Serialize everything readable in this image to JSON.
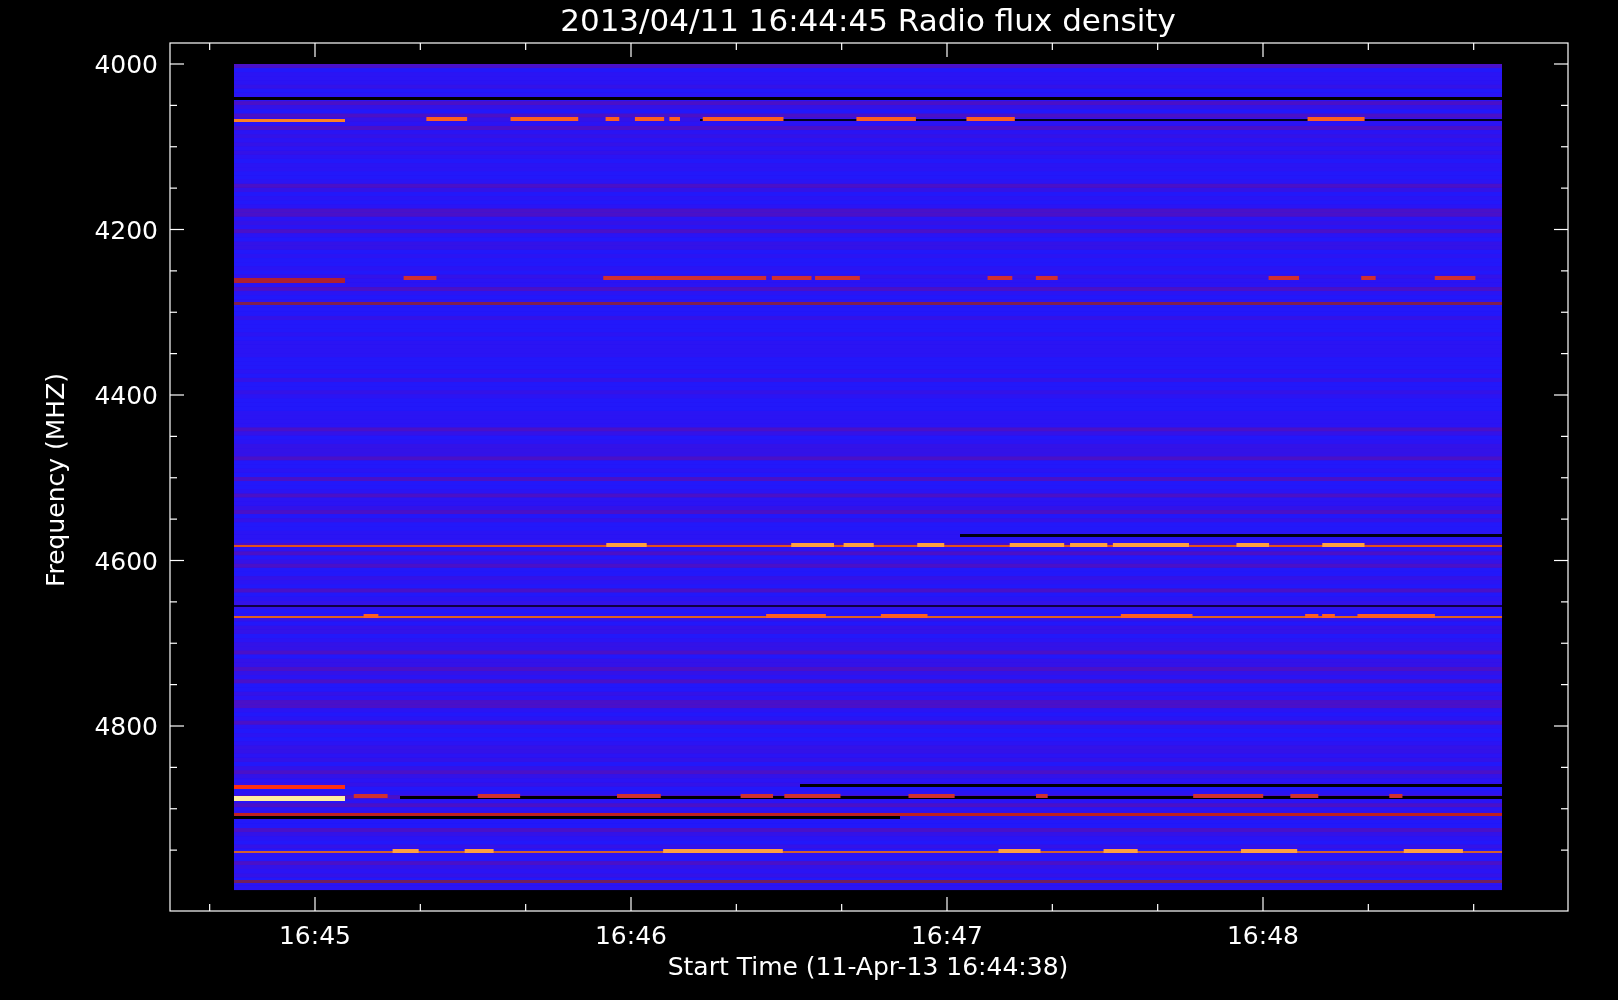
{
  "title": "2013/04/11 16:44:45 Radio flux density",
  "y_axis": {
    "label": "Frequency (MHZ)",
    "ticks": [
      "4000",
      "4200",
      "4400",
      "4600",
      "4800"
    ]
  },
  "x_axis": {
    "label": "Start Time (11-Apr-13 16:44:38)",
    "ticks": [
      "16:45",
      "16:46",
      "16:47",
      "16:48"
    ]
  }
}
